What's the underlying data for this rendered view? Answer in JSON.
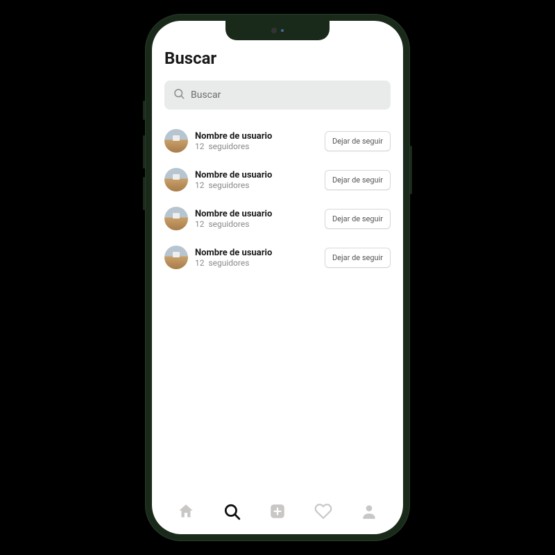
{
  "header": {
    "title": "Buscar"
  },
  "search": {
    "placeholder": "Buscar"
  },
  "followers_word": "seguidores",
  "unfollow_label": "Dejar de seguir",
  "users": [
    {
      "name": "Nombre de usuario",
      "followers": 12
    },
    {
      "name": "Nombre de usuario",
      "followers": 12
    },
    {
      "name": "Nombre de usuario",
      "followers": 12
    },
    {
      "name": "Nombre de usuario",
      "followers": 12
    }
  ],
  "nav": {
    "active": "search",
    "items": [
      "home",
      "search",
      "create",
      "likes",
      "profile"
    ]
  }
}
